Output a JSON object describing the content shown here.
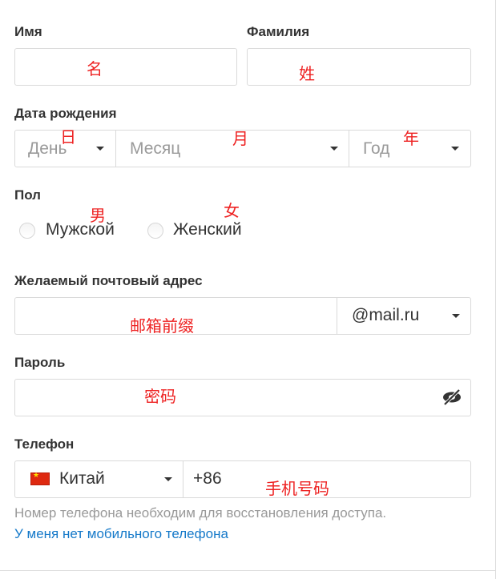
{
  "form": {
    "first_name": {
      "label": "Имя",
      "annotation": "名",
      "value": ""
    },
    "last_name": {
      "label": "Фамилия",
      "annotation": "姓",
      "value": ""
    },
    "birth_date": {
      "label": "Дата рождения",
      "day": {
        "placeholder": "День",
        "annotation": "日"
      },
      "month": {
        "placeholder": "Месяц",
        "annotation": "月"
      },
      "year": {
        "placeholder": "Год",
        "annotation": "年"
      }
    },
    "gender": {
      "label": "Пол",
      "options": [
        {
          "label": "Мужской",
          "annotation": "男",
          "selected": false
        },
        {
          "label": "Женский",
          "annotation": "女",
          "selected": false
        }
      ]
    },
    "email": {
      "label": "Желаемый почтовый адрес",
      "annotation": "邮箱前缀",
      "value": "",
      "domain": "@mail.ru"
    },
    "password": {
      "label": "Пароль",
      "annotation": "密码",
      "value": "",
      "toggle_icon": "eye-slash-icon"
    },
    "phone": {
      "label": "Телефон",
      "country": "Китай",
      "country_flag": "china-flag-icon",
      "code": "+86",
      "annotation": "手机号码",
      "hint": "Номер телефона необходим для восстановления доступа.",
      "no_phone_link": "У меня нет мобильного телефона"
    }
  },
  "colors": {
    "link": "#1579c9",
    "annotation": "#ee2222",
    "border": "#dadada"
  }
}
